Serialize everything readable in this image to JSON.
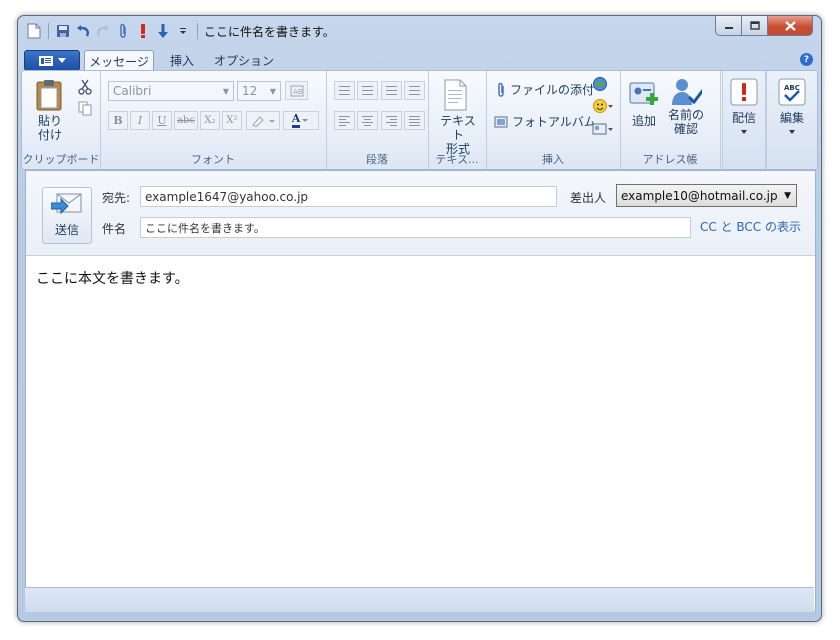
{
  "window": {
    "title": "ここに件名を書きます。"
  },
  "tabs": [
    {
      "label": "メッセージ"
    },
    {
      "label": "挿入"
    },
    {
      "label": "オプション"
    }
  ],
  "ribbon": {
    "clipboard": {
      "label": "クリップボード",
      "paste_label_1": "貼り",
      "paste_label_2": "付け"
    },
    "font": {
      "label": "フォント",
      "font_name": "Calibri",
      "font_size": "12",
      "bold": "B",
      "italic": "I",
      "underline": "U",
      "strike": "abc",
      "subscript": "X₂",
      "superscript": "X²",
      "color": "A"
    },
    "paragraph": {
      "label": "段落"
    },
    "text_format": {
      "label": "テキス...",
      "button_1": "テキスト",
      "button_2": "形式"
    },
    "insert": {
      "label": "挿入",
      "attach_file": "ファイルの添付",
      "photo_album": "フォトアルバム"
    },
    "address_book": {
      "label": "アドレス帳",
      "add": "追加",
      "check_names_1": "名前の",
      "check_names_2": "確認"
    },
    "deliver": {
      "label": "配信"
    },
    "edit": {
      "label": "編集"
    }
  },
  "compose": {
    "send_label": "送信",
    "to_label": "宛先:",
    "to_value": "example1647@yahoo.co.jp",
    "subject_label": "件名",
    "subject_value": "ここに件名を書きます。",
    "from_label": "差出人",
    "from_value": "example10@hotmail.co.jp",
    "cc_bcc_link": "CC と BCC の表示",
    "body": "ここに本文を書きます。"
  },
  "colors": {
    "accent": "#2a67b8",
    "frame": "#b7c9e3",
    "close": "#c74f36"
  }
}
